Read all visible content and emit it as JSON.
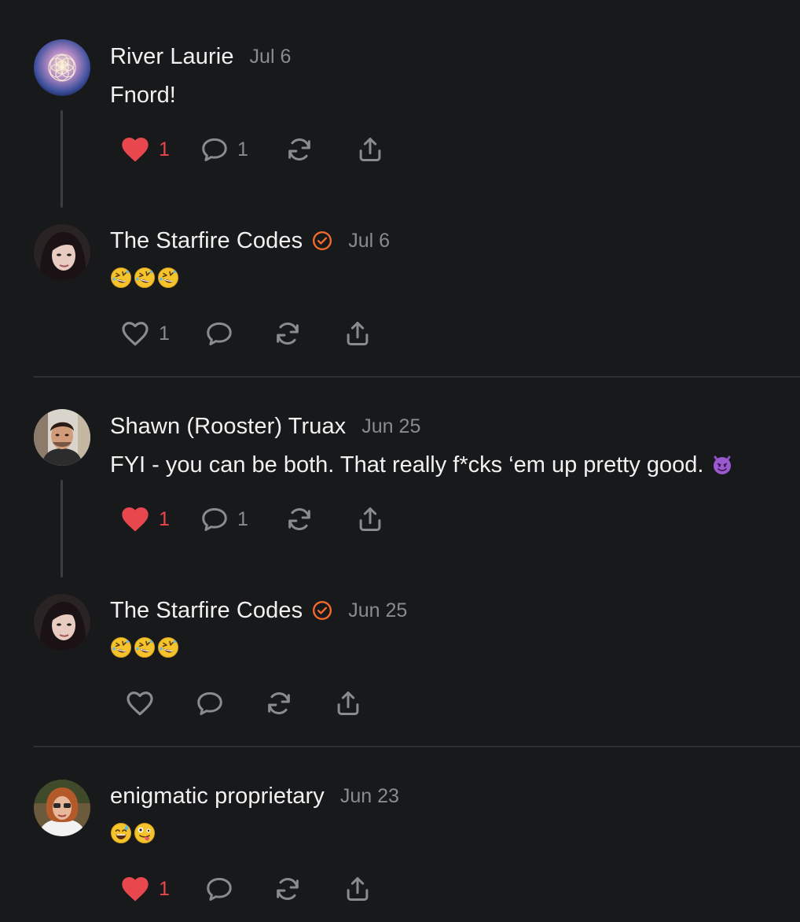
{
  "colors": {
    "background": "#18191b",
    "text": "#f1f1f1",
    "muted": "#8a8b8f",
    "like_active": "#e9474e",
    "verified_badge": "#f26b2b",
    "divider": "#2f3033"
  },
  "comments": [
    {
      "author": "River Laurie",
      "date": "Jul 6",
      "text": "Fnord!",
      "avatar": "flower-of-life-avatar",
      "liked": true,
      "like_count": "1",
      "reply_count": "1"
    },
    {
      "author": "The Starfire Codes",
      "verified": true,
      "date": "Jul 6",
      "emojis": [
        "rofl-emoji",
        "rofl-emoji",
        "rofl-emoji"
      ],
      "avatar": "woman-dark-hair-avatar",
      "liked": false,
      "like_count": "1"
    },
    {
      "author": "Shawn (Rooster) Truax",
      "date": "Jun 25",
      "text": "FYI - you can be both. That really f*cks ‘em up pretty good.",
      "trailing_emoji": "smiling-imp-emoji",
      "avatar": "man-portrait-avatar",
      "liked": true,
      "like_count": "1",
      "reply_count": "1"
    },
    {
      "author": "The Starfire Codes",
      "verified": true,
      "date": "Jun 25",
      "emojis": [
        "rofl-emoji",
        "rofl-emoji",
        "rofl-emoji"
      ],
      "avatar": "woman-dark-hair-avatar",
      "liked": false
    },
    {
      "author": "enigmatic proprietary",
      "date": "Jun 23",
      "emojis": [
        "sweat-smile-emoji",
        "zany-face-emoji"
      ],
      "avatar": "woman-sunglasses-avatar",
      "liked": true,
      "like_count": "1"
    }
  ],
  "icons": {
    "like": "heart-icon",
    "reply": "comment-bubble-icon",
    "restack": "restack-arrows-icon",
    "share": "share-upload-icon",
    "verified": "verified-check-badge-icon"
  }
}
